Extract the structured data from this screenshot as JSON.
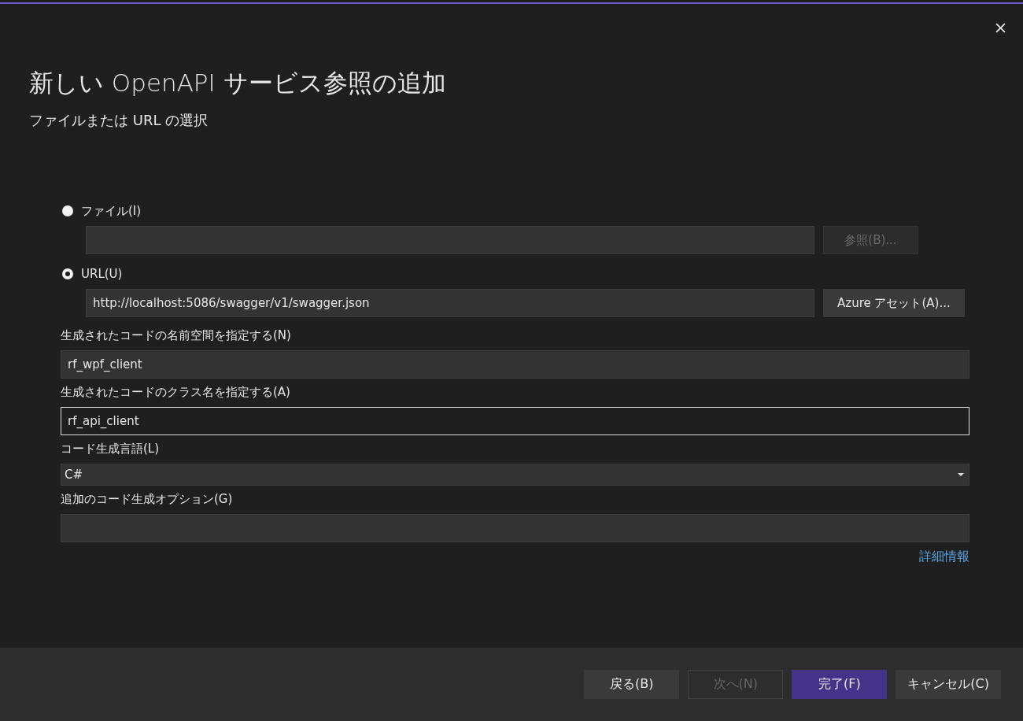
{
  "dialog": {
    "title": "新しい OpenAPI サービス参照の追加",
    "subtitle": "ファイルまたは URL の選択"
  },
  "sources": [
    {
      "label": "ファイル(I)",
      "selected": false,
      "button": {
        "label": "参照(B)...",
        "disabled": true
      }
    },
    {
      "label": "URL(U)",
      "selected": true,
      "value": "http://localhost:5086/swagger/v1/swagger.json",
      "button": {
        "label": "Azure アセット(A)...",
        "disabled": false
      }
    }
  ],
  "fields": [
    {
      "kind": "text",
      "label": "生成されたコードの名前空間を指定する(N)",
      "value": "rf_wpf_client",
      "focused": false
    },
    {
      "kind": "text",
      "label": "生成されたコードのクラス名を指定する(A)",
      "value": "rf_api_client",
      "focused": true
    },
    {
      "kind": "dropdown",
      "label": "コード生成言語(L)",
      "value": "C#"
    },
    {
      "kind": "text",
      "label": "追加のコード生成オプション(G)",
      "focused": false
    }
  ],
  "more_info_link": "詳細情報",
  "footer_buttons": [
    {
      "label": "戻る(B)",
      "kind": "normal",
      "disabled": false
    },
    {
      "label": "次へ(N)",
      "kind": "normal",
      "disabled": true
    },
    {
      "label": "完了(F)",
      "kind": "primary",
      "disabled": false
    },
    {
      "label": "キャンセル(C)",
      "kind": "normal",
      "disabled": false
    }
  ]
}
